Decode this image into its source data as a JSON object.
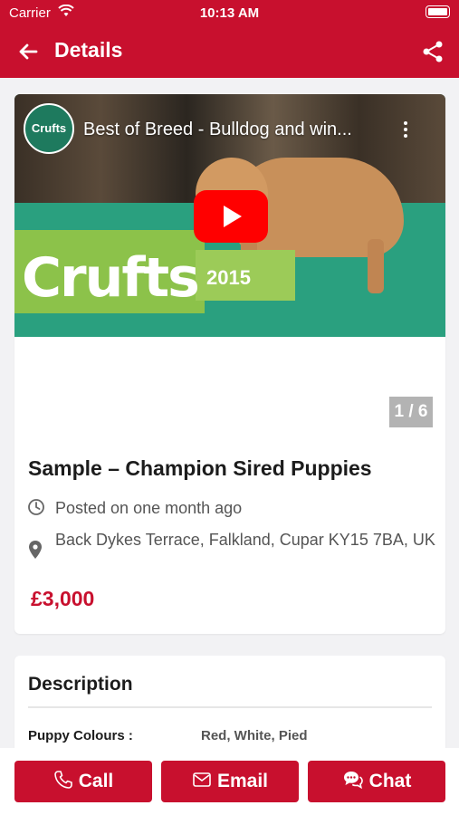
{
  "status_bar": {
    "carrier": "Carrier",
    "time": "10:13 AM"
  },
  "nav": {
    "title": "Details"
  },
  "video": {
    "channel_logo_text": "Crufts",
    "title": "Best of Breed - Bulldog and win...",
    "thumbnail_brand": "Crufts",
    "thumbnail_year": "2015"
  },
  "gallery": {
    "counter": "1 / 6"
  },
  "listing": {
    "title": "Sample – Champion Sired Puppies",
    "posted": "Posted on one month ago",
    "address": "Back Dykes Terrace, Falkland, Cupar KY15 7BA, UK",
    "price": "£3,000"
  },
  "description": {
    "title": "Description",
    "attributes": [
      {
        "label": "Puppy Colours :",
        "value": "Red, White, Pied"
      }
    ]
  },
  "actions": {
    "call": "Call",
    "email": "Email",
    "chat": "Chat"
  },
  "colors": {
    "brand": "#c8102e",
    "youtube_red": "#ff0000"
  },
  "icons": [
    "back-arrow-icon",
    "share-icon",
    "clock-icon",
    "location-pin-icon",
    "phone-icon",
    "mail-icon",
    "chat-bubble-icon",
    "more-vertical-icon",
    "play-icon",
    "wifi-icon",
    "battery-icon"
  ]
}
